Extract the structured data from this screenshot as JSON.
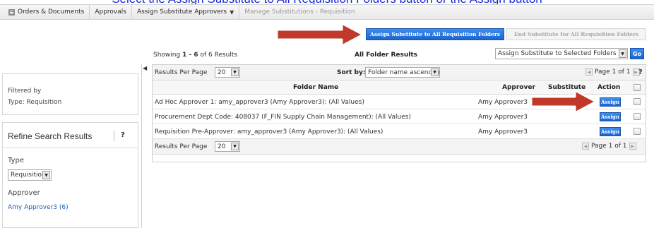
{
  "caption": "Select the Assign Substitute to All Requisition Folders button or the Assign button",
  "breadcrumb": {
    "items": [
      {
        "label": "Orders & Documents"
      },
      {
        "label": "Approvals"
      },
      {
        "label": "Assign Substitute Approvers"
      },
      {
        "label": "Manage Substitutions - Requisition"
      }
    ]
  },
  "actions": {
    "assign_all_label": "Assign Substitute to All Requisition Folders",
    "end_all_label": "End Substitute for All Requisition Folders"
  },
  "results": {
    "showing_prefix": "Showing",
    "range": "1 - 6",
    "of_text": "of 6 Results",
    "title": "All Folder Results",
    "bulk_action_value": "Assign Substitute to Selected Folders",
    "go_label": "Go"
  },
  "sidebar": {
    "filtered_by": "Filtered by",
    "filter_type": "Type: Requisition",
    "refine_title": "Refine Search Results",
    "help": "?",
    "type_label": "Type",
    "type_value": "Requisition",
    "approver_label": "Approver",
    "approver_value": "Amy Approver3 (6)"
  },
  "table": {
    "rpp_label": "Results Per Page",
    "rpp_value": "20",
    "sort_label": "Sort by:",
    "sort_value": "Folder name ascending",
    "page_text": "Page 1 of 1",
    "help": "?",
    "columns": {
      "folder_name": "Folder Name",
      "approver": "Approver",
      "substitute": "Substitute",
      "action": "Action"
    },
    "rows": [
      {
        "folder": "Ad Hoc Approver 1: amy_approver3 (Amy Approver3): (All Values)",
        "approver": "Amy Approver3",
        "action": "Assign"
      },
      {
        "folder": "Procurement Dept Code: 408037 (F_FIN Supply Chain Management): (All Values)",
        "approver": "Amy Approver3",
        "action": "Assign"
      },
      {
        "folder": "Requisition Pre-Approver: amy_approver3 (Amy Approver3): (All Values)",
        "approver": "Amy Approver3",
        "action": "Assign"
      }
    ]
  },
  "colors": {
    "button_blue": "#1c64cf",
    "arrow_red": "#c0392b",
    "caption_blue": "#1a2bd6"
  }
}
